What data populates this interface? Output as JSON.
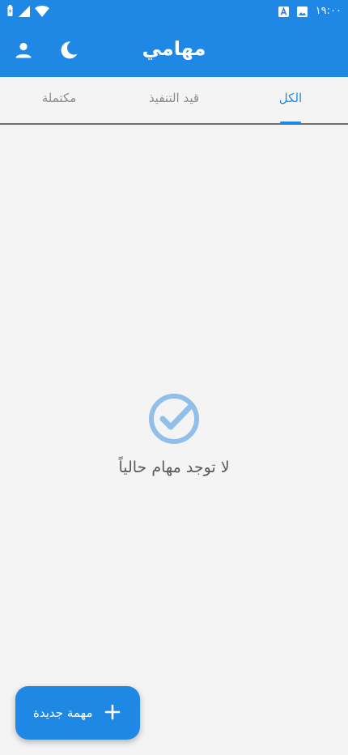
{
  "status_bar": {
    "time": "١٩:٠٠",
    "icons": [
      "battery-charging-icon",
      "cell-signal-icon",
      "wifi-icon",
      "a-notification-icon",
      "image-notification-icon"
    ]
  },
  "app_bar": {
    "title": "مهامي",
    "icons": [
      "dark-mode-moon-icon",
      "user-profile-icon"
    ]
  },
  "tabs": [
    {
      "label": "الكل",
      "active": true
    },
    {
      "label": "قيد التنفيذ",
      "active": false
    },
    {
      "label": "مكتملة",
      "active": false
    }
  ],
  "empty_state": {
    "icon": "check-circle-icon",
    "message": "لا توجد مهام حالياً"
  },
  "fab": {
    "label": "مهمة جديدة",
    "icon": "plus-icon"
  },
  "colors": {
    "primary": "#1f88e5",
    "background": "#f4f4f4",
    "icon_light": "#90bfe9"
  }
}
